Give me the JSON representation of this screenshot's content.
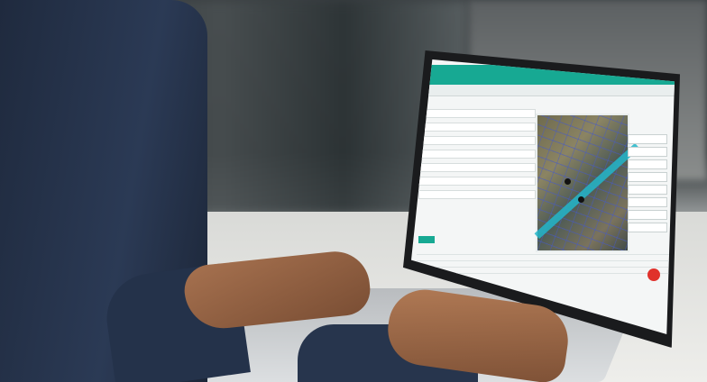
{
  "scene": {
    "description_visible_text": []
  },
  "colors": {
    "app_accent": "#17a993",
    "map_route": "#23b6c9",
    "fab_red": "#e0312b",
    "clothing_navy": "#24324a"
  },
  "icons": {
    "map_pin": "map-pin-icon",
    "action_fab": "red-action-button-icon"
  }
}
